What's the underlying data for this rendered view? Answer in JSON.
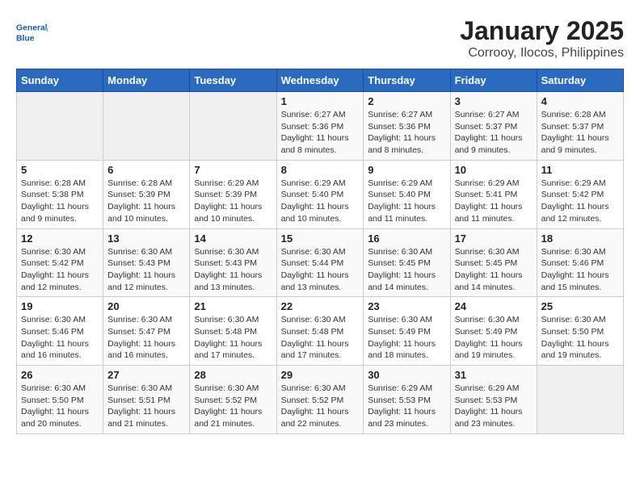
{
  "header": {
    "logo_text_general": "General",
    "logo_text_blue": "Blue",
    "title": "January 2025",
    "subtitle": "Corrooy, Ilocos, Philippines"
  },
  "days_of_week": [
    "Sunday",
    "Monday",
    "Tuesday",
    "Wednesday",
    "Thursday",
    "Friday",
    "Saturday"
  ],
  "weeks": [
    [
      {
        "day": "",
        "info": ""
      },
      {
        "day": "",
        "info": ""
      },
      {
        "day": "",
        "info": ""
      },
      {
        "day": "1",
        "info": "Sunrise: 6:27 AM\nSunset: 5:36 PM\nDaylight: 11 hours and 8 minutes."
      },
      {
        "day": "2",
        "info": "Sunrise: 6:27 AM\nSunset: 5:36 PM\nDaylight: 11 hours and 8 minutes."
      },
      {
        "day": "3",
        "info": "Sunrise: 6:27 AM\nSunset: 5:37 PM\nDaylight: 11 hours and 9 minutes."
      },
      {
        "day": "4",
        "info": "Sunrise: 6:28 AM\nSunset: 5:37 PM\nDaylight: 11 hours and 9 minutes."
      }
    ],
    [
      {
        "day": "5",
        "info": "Sunrise: 6:28 AM\nSunset: 5:38 PM\nDaylight: 11 hours and 9 minutes."
      },
      {
        "day": "6",
        "info": "Sunrise: 6:28 AM\nSunset: 5:39 PM\nDaylight: 11 hours and 10 minutes."
      },
      {
        "day": "7",
        "info": "Sunrise: 6:29 AM\nSunset: 5:39 PM\nDaylight: 11 hours and 10 minutes."
      },
      {
        "day": "8",
        "info": "Sunrise: 6:29 AM\nSunset: 5:40 PM\nDaylight: 11 hours and 10 minutes."
      },
      {
        "day": "9",
        "info": "Sunrise: 6:29 AM\nSunset: 5:40 PM\nDaylight: 11 hours and 11 minutes."
      },
      {
        "day": "10",
        "info": "Sunrise: 6:29 AM\nSunset: 5:41 PM\nDaylight: 11 hours and 11 minutes."
      },
      {
        "day": "11",
        "info": "Sunrise: 6:29 AM\nSunset: 5:42 PM\nDaylight: 11 hours and 12 minutes."
      }
    ],
    [
      {
        "day": "12",
        "info": "Sunrise: 6:30 AM\nSunset: 5:42 PM\nDaylight: 11 hours and 12 minutes."
      },
      {
        "day": "13",
        "info": "Sunrise: 6:30 AM\nSunset: 5:43 PM\nDaylight: 11 hours and 12 minutes."
      },
      {
        "day": "14",
        "info": "Sunrise: 6:30 AM\nSunset: 5:43 PM\nDaylight: 11 hours and 13 minutes."
      },
      {
        "day": "15",
        "info": "Sunrise: 6:30 AM\nSunset: 5:44 PM\nDaylight: 11 hours and 13 minutes."
      },
      {
        "day": "16",
        "info": "Sunrise: 6:30 AM\nSunset: 5:45 PM\nDaylight: 11 hours and 14 minutes."
      },
      {
        "day": "17",
        "info": "Sunrise: 6:30 AM\nSunset: 5:45 PM\nDaylight: 11 hours and 14 minutes."
      },
      {
        "day": "18",
        "info": "Sunrise: 6:30 AM\nSunset: 5:46 PM\nDaylight: 11 hours and 15 minutes."
      }
    ],
    [
      {
        "day": "19",
        "info": "Sunrise: 6:30 AM\nSunset: 5:46 PM\nDaylight: 11 hours and 16 minutes."
      },
      {
        "day": "20",
        "info": "Sunrise: 6:30 AM\nSunset: 5:47 PM\nDaylight: 11 hours and 16 minutes."
      },
      {
        "day": "21",
        "info": "Sunrise: 6:30 AM\nSunset: 5:48 PM\nDaylight: 11 hours and 17 minutes."
      },
      {
        "day": "22",
        "info": "Sunrise: 6:30 AM\nSunset: 5:48 PM\nDaylight: 11 hours and 17 minutes."
      },
      {
        "day": "23",
        "info": "Sunrise: 6:30 AM\nSunset: 5:49 PM\nDaylight: 11 hours and 18 minutes."
      },
      {
        "day": "24",
        "info": "Sunrise: 6:30 AM\nSunset: 5:49 PM\nDaylight: 11 hours and 19 minutes."
      },
      {
        "day": "25",
        "info": "Sunrise: 6:30 AM\nSunset: 5:50 PM\nDaylight: 11 hours and 19 minutes."
      }
    ],
    [
      {
        "day": "26",
        "info": "Sunrise: 6:30 AM\nSunset: 5:50 PM\nDaylight: 11 hours and 20 minutes."
      },
      {
        "day": "27",
        "info": "Sunrise: 6:30 AM\nSunset: 5:51 PM\nDaylight: 11 hours and 21 minutes."
      },
      {
        "day": "28",
        "info": "Sunrise: 6:30 AM\nSunset: 5:52 PM\nDaylight: 11 hours and 21 minutes."
      },
      {
        "day": "29",
        "info": "Sunrise: 6:30 AM\nSunset: 5:52 PM\nDaylight: 11 hours and 22 minutes."
      },
      {
        "day": "30",
        "info": "Sunrise: 6:29 AM\nSunset: 5:53 PM\nDaylight: 11 hours and 23 minutes."
      },
      {
        "day": "31",
        "info": "Sunrise: 6:29 AM\nSunset: 5:53 PM\nDaylight: 11 hours and 23 minutes."
      },
      {
        "day": "",
        "info": ""
      }
    ]
  ]
}
